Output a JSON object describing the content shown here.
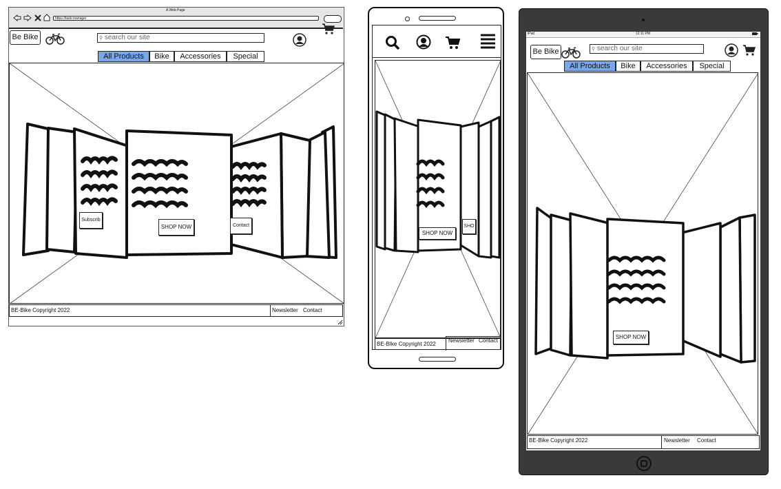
{
  "browser": {
    "window_title": "A Web Page",
    "url": "https://task-manager"
  },
  "site": {
    "logo_label": "Be Bike",
    "search_placeholder": "search our site",
    "nav_tabs": [
      {
        "label": "All Products",
        "active": true
      },
      {
        "label": "Bike",
        "active": false
      },
      {
        "label": "Accessories",
        "active": false
      },
      {
        "label": "Special",
        "active": false
      }
    ],
    "carousel": {
      "center_button": "SHOP NOW",
      "left_button": "Subscrib",
      "right_button": "Contact",
      "mobile_right_button": "SHO"
    },
    "footer": {
      "copyright": "BE-Bike Copyright 2022",
      "mobile_copyright": "BE-BIke Copyright 2022",
      "newsletter": "Newsletter",
      "contact": "Contact"
    }
  },
  "tablet": {
    "status_left": "iPad",
    "status_time": "12:11 PM"
  },
  "colors": {
    "active_tab": "#7aa6ea",
    "tablet_frame": "#3a3a3a"
  },
  "icons": [
    "back-icon",
    "forward-icon",
    "close-icon",
    "home-icon",
    "search-icon",
    "bike-icon",
    "user-icon",
    "cart-icon",
    "hamburger-icon",
    "home-button-icon"
  ]
}
